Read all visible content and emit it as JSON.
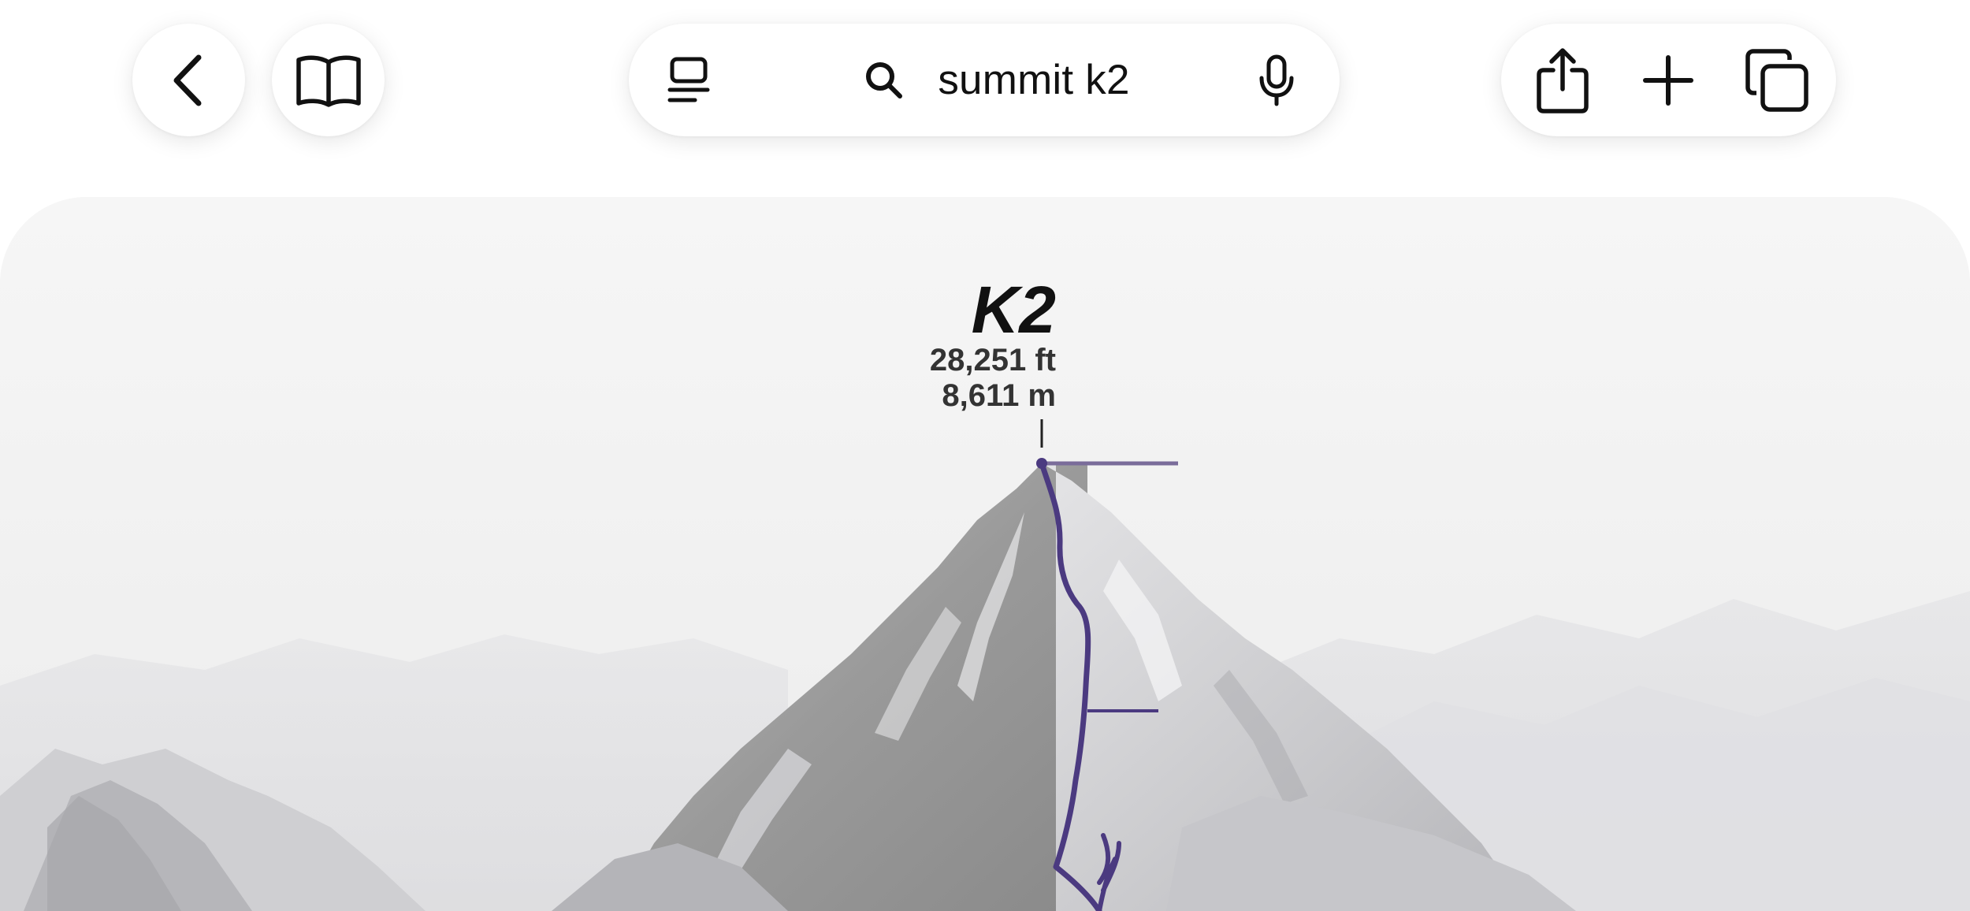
{
  "browser": {
    "address_bar": {
      "query": "summit k2"
    }
  },
  "image": {
    "title": "K2",
    "elevation_ft": "28,251 ft",
    "elevation_m": "8,611 m"
  },
  "colors": {
    "route": "#4b3a80",
    "background": "#f4f4f4"
  },
  "icons": [
    "back-icon",
    "reader-icon",
    "page-menu-icon",
    "search-icon",
    "microphone-icon",
    "share-icon",
    "plus-icon",
    "tabs-icon"
  ]
}
